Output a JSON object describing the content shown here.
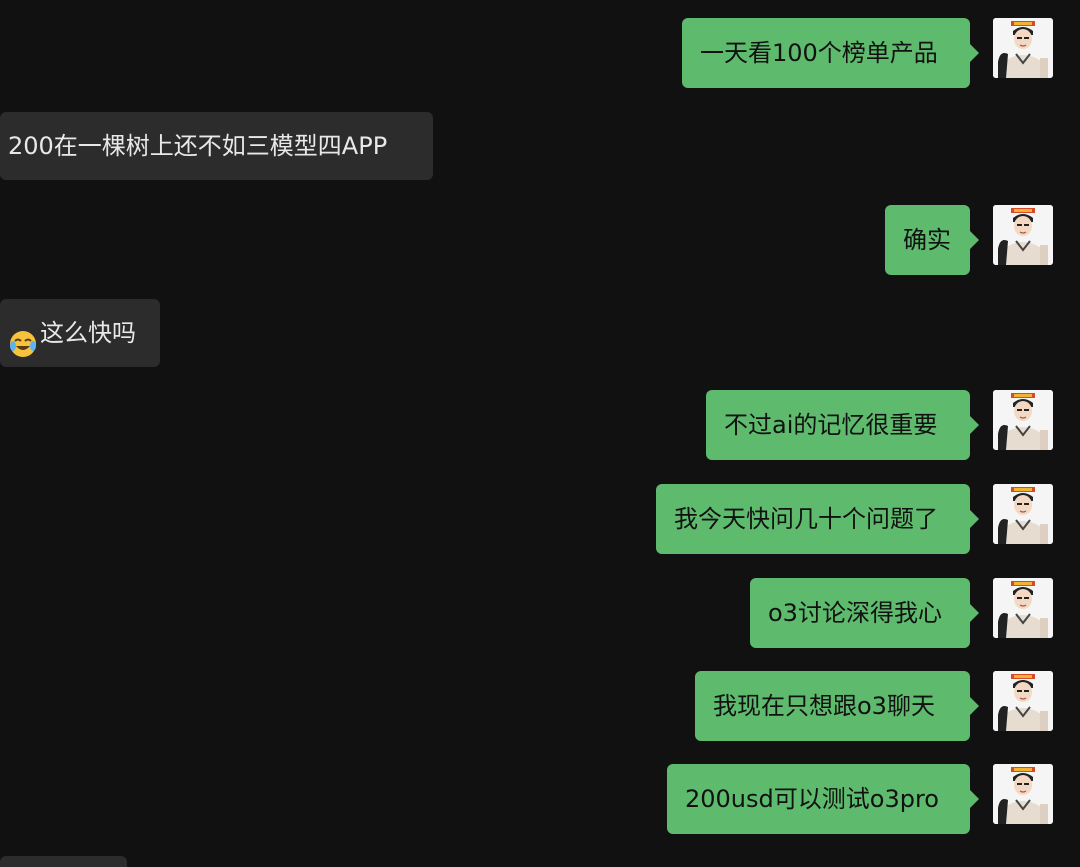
{
  "messages": [
    {
      "side": "out",
      "text": "一天看100个榜单产品"
    },
    {
      "side": "in",
      "text": "200在一棵树上还不如三模型四APP"
    },
    {
      "side": "out",
      "text": "确实"
    },
    {
      "side": "in",
      "text": "这么快吗",
      "emoji": "laughing-with-tears-emoji"
    },
    {
      "side": "out",
      "text": "不过ai的记忆很重要"
    },
    {
      "side": "out",
      "text": "我今天快问几十个问题了"
    },
    {
      "side": "out",
      "text": "o3讨论深得我心"
    },
    {
      "side": "out",
      "text": "我现在只想跟o3聊天"
    },
    {
      "side": "out",
      "text": "200usd可以测试o3pro"
    }
  ],
  "colors": {
    "background": "#111111",
    "outgoing_bubble": "#5ebb6e",
    "incoming_bubble": "#2c2c2c"
  },
  "icons": {
    "avatar": "user-avatar-cartoon"
  }
}
